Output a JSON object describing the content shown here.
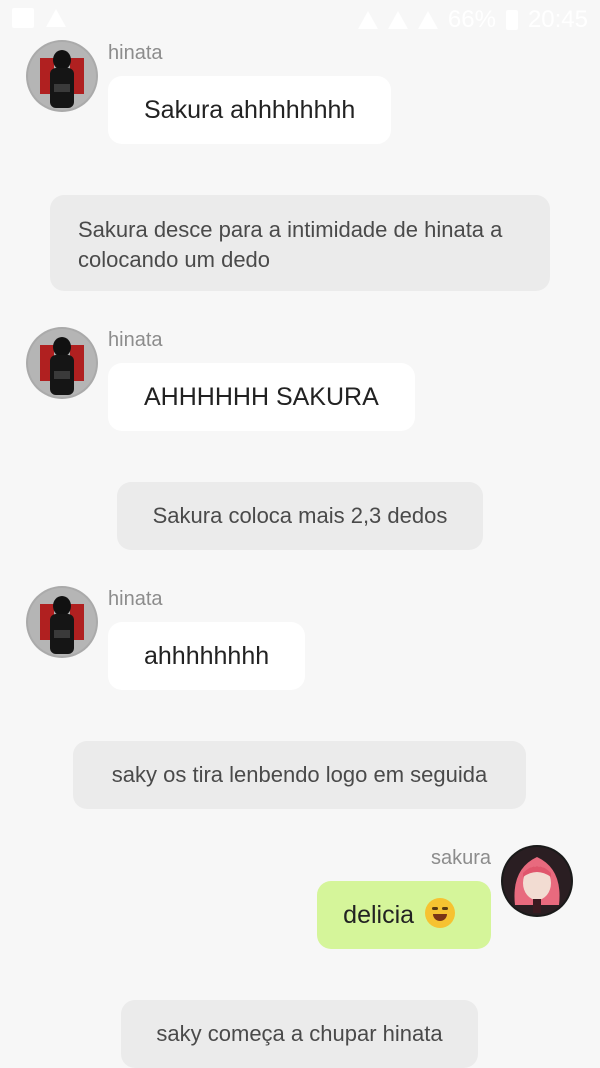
{
  "status_bar": {
    "battery": "66%",
    "time": "20:45"
  },
  "messages": [
    {
      "sender": "hinata",
      "text": "Sakura ahhhhhhhh"
    },
    {
      "narration": "Sakura desce para a intimidade de hinata a colocando um dedo"
    },
    {
      "sender": "hinata",
      "text": "AHHHHHH SAKURA"
    },
    {
      "narration": "Sakura coloca mais 2,3 dedos"
    },
    {
      "sender": "hinata",
      "text": "ahhhhhhhh"
    },
    {
      "narration": "saky os tira lenbendo logo em seguida"
    },
    {
      "sender": "sakura",
      "text": "delicia",
      "emoji": "grinning-face-with-tongue-emoji"
    },
    {
      "narration": "saky começa a chupar hinata"
    }
  ],
  "colors": {
    "background": "#f7f7f7",
    "incoming_bubble": "#ffffff",
    "outgoing_bubble": "#d5f59a",
    "narration_bubble": "#ebebeb",
    "sender_name": "#8c8c8c"
  }
}
